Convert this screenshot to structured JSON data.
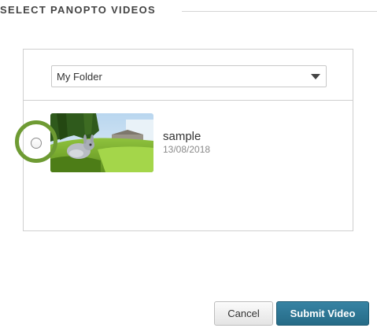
{
  "header": {
    "title": "SELECT PANOPTO VIDEOS"
  },
  "folder_select": {
    "selected": "My Folder",
    "icon": "chevron-down-icon"
  },
  "videos": [
    {
      "title": "sample",
      "date": "13/08/2018",
      "selected": false,
      "thumbnail": "video-thumbnail-image"
    }
  ],
  "highlight_color": "#6e9b33",
  "buttons": {
    "cancel_label": "Cancel",
    "submit_label": "Submit Video",
    "submit_color": "#2d7696"
  }
}
